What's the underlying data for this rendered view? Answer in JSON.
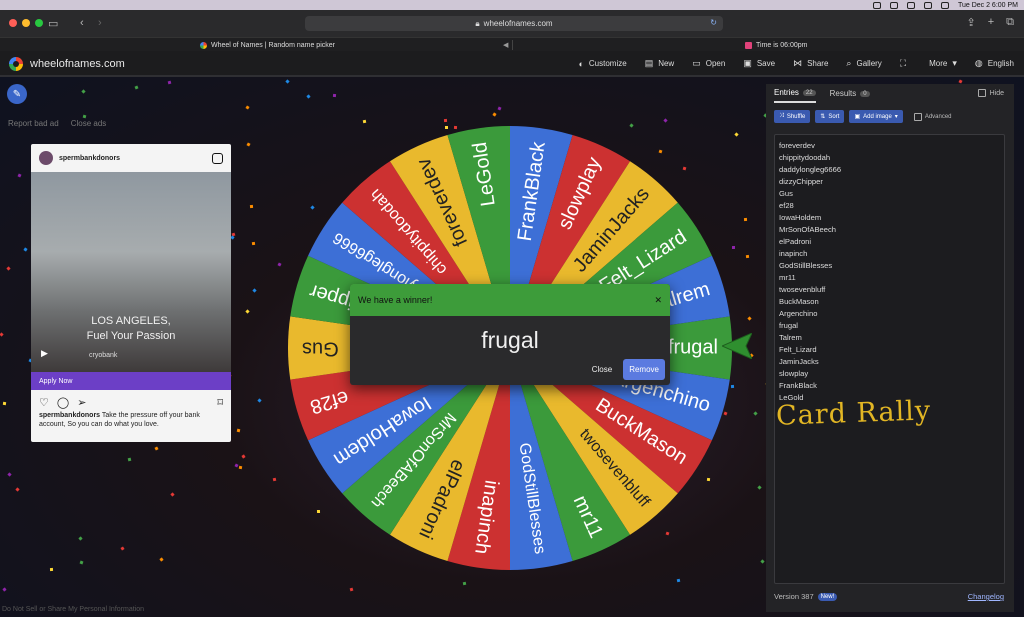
{
  "menubar": {
    "date_time": "Tue Dec 2  6:00 PM"
  },
  "browser": {
    "url": "wheelofnames.com",
    "tabs": [
      {
        "title": "Wheel of Names | Random name picker"
      },
      {
        "title": "Time is 06:00pm"
      }
    ]
  },
  "app": {
    "brand": "wheelofnames.com",
    "nav": [
      {
        "label": "Customize",
        "icon": "palette-icon"
      },
      {
        "label": "New",
        "icon": "file-icon"
      },
      {
        "label": "Open",
        "icon": "folder-icon"
      },
      {
        "label": "Save",
        "icon": "save-icon"
      },
      {
        "label": "Share",
        "icon": "share-icon"
      },
      {
        "label": "Gallery",
        "icon": "search-icon"
      },
      {
        "label": "",
        "icon": "fullscreen-icon"
      },
      {
        "label": "More",
        "icon": "chevron-down-icon"
      },
      {
        "label": "English",
        "icon": "globe-icon"
      }
    ]
  },
  "adbar": {
    "report": "Report bad ad",
    "close": "Close ads"
  },
  "ad": {
    "account": "spermbankdonors",
    "headline1": "LOS ANGELES,",
    "headline2": "Fuel Your Passion",
    "brand": "cryobank",
    "cta": "Apply Now",
    "caption_user": "spermbankdonors",
    "caption_text": "Take the pressure off your bank account, So you can do what you love."
  },
  "winner": {
    "title": "We have a winner!",
    "name": "frugal",
    "close_label": "Close",
    "remove_label": "Remove"
  },
  "panel": {
    "tab_entries": "Entries",
    "entries_count": "22",
    "tab_results": "Results",
    "results_count": "0",
    "hide_label": "Hide",
    "shuffle": "Shuffle",
    "sort": "Sort",
    "add_image": "Add image",
    "advanced": "Advanced",
    "entries": [
      "foreverdev",
      "chippitydoodah",
      "daddylongleg6666",
      "dizzyChipper",
      "Gus",
      "ef28",
      "IowaHoldem",
      "MrSonOfABeech",
      "elPadroni",
      "inapinch",
      "GodStillBlesses",
      "mr11",
      "twosevenbluff",
      "BuckMason",
      "Argenchino",
      "frugal",
      "Talrem",
      "Felt_Lizard",
      "JaminJacks",
      "slowplay",
      "FrankBlack",
      "LeGold"
    ],
    "handwriting": "Card Rally",
    "version": "Version 387",
    "new_badge": "New!",
    "changelog": "Changelog"
  },
  "wheel": {
    "colors": [
      "#3b9a3b",
      "#3d6fd6",
      "#cc3131",
      "#e9b92d"
    ],
    "segments": [
      "frugal",
      "Argenchino",
      "BuckMason",
      "twosevenbluff",
      "mr11",
      "GodStillBlesses",
      "inapinch",
      "elPadroni",
      "MrSonOfABeech",
      "IowaHoldem",
      "ef28",
      "Gus",
      "dizzyChipper",
      "daddylongleg6666",
      "chippitydoodah",
      "foreverdev",
      "LeGold",
      "FrankBlack",
      "slowplay",
      "JaminJacks",
      "Felt_Lizard",
      "Talrem"
    ]
  },
  "footer": {
    "dnsell": "Do Not Sell or Share My Personal Information"
  }
}
